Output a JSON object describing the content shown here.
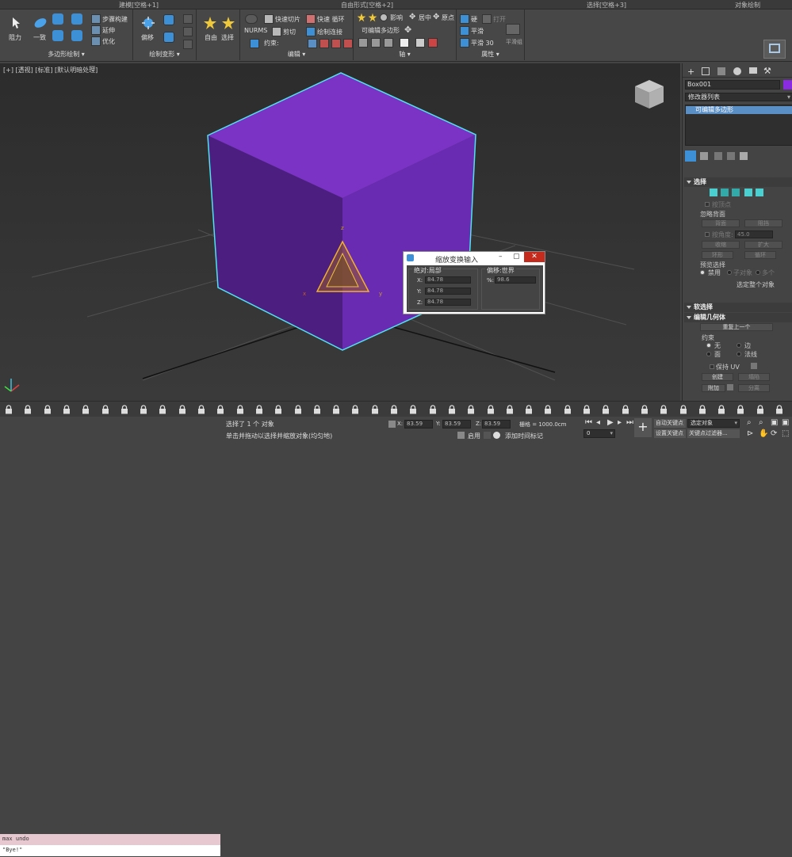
{
  "ribbon": {
    "tabs": [
      "建模[空格+1]",
      "自由形式[空格+2]",
      "选择[空格+3]",
      "对象绘制"
    ],
    "groups": {
      "poly": {
        "label": "多边形绘制",
        "items": [
          "阻力",
          "一致",
          "步骤构建",
          "延伸",
          "优化"
        ]
      },
      "deform": {
        "label": "绘制变形",
        "items": [
          "偏移"
        ]
      },
      "freeform": {
        "items": [
          "自由",
          "选择"
        ]
      },
      "edit": {
        "label": "编辑",
        "items": [
          "NURMS",
          "快速切片",
          "剪切",
          "快速 循环",
          "绘制连接",
          "约束:",
          "可编辑多边形"
        ]
      },
      "axis": {
        "label": "轴",
        "items": [
          "影响",
          "居中",
          "原点"
        ]
      },
      "props": {
        "label": "属性",
        "items": [
          "硬",
          "平滑",
          "平滑 30",
          "打开",
          "平滑组"
        ]
      }
    }
  },
  "viewport": {
    "label": "[+] [透视] [标准] [默认明暗处理]",
    "gizmo_labels": {
      "x": "x",
      "y": "y",
      "z": "z"
    },
    "cube_color": "#6a2bb3",
    "wire_color": "#4fe3f0"
  },
  "command_panel": {
    "object_name": "Box001",
    "object_color": "#8a2be2",
    "modifier_list": "修改器列表",
    "stack_item": "可编辑多边形",
    "selection": {
      "title": "选择",
      "by_vertex": "按顶点",
      "ignore_back": "忽略背面",
      "by_angle": "按角度:",
      "angle_value": "45.0",
      "shrink": "收缩",
      "grow": "扩大",
      "ring": "环形",
      "loop": "循环",
      "preview_title": "预览选择",
      "preview_opts": [
        "禁用",
        "子对象",
        "多个"
      ],
      "status": "选定整个对象",
      "front": "背面",
      "occluded": "阻挡"
    },
    "soft_selection": "软选择",
    "edit_geometry": {
      "title": "编辑几何体",
      "repeat_last": "重复上一个",
      "constraints": "约束",
      "constraint_opts": [
        "无",
        "边",
        "面",
        "法线"
      ],
      "preserve_uvs": "保持 UV",
      "create": "创建",
      "collapse": "塌陷",
      "attach": "附加",
      "detach": "分离"
    }
  },
  "dialog": {
    "title": "缩放变换输入",
    "absolute_label": "绝对:局部",
    "offset_label": "偏移:世界",
    "x_label": "X:",
    "y_label": "Y:",
    "z_label": "Z:",
    "x_value": "84.78",
    "y_value": "84.78",
    "z_value": "84.78",
    "pct_label": "%:",
    "pct_value": "98.6"
  },
  "status": {
    "maxscript_line1": "max undo",
    "maxscript_line2": "\"Bye!\"",
    "selected": "选择了 1 个 对象",
    "prompt": "单击并拖动以选择并缩放对象(均匀地)",
    "x_label": "X:",
    "x_value": "83.59",
    "y_label": "Y:",
    "y_value": "83.59",
    "z_label": "Z:",
    "z_value": "83.59",
    "grid": "栅格 = 1000.0cm",
    "enable": "启用",
    "add_time_tag": "添加时间标记",
    "auto_key": "自动关键点",
    "set_key": "设置关键点",
    "selection_set": "选定对象",
    "key_filters": "关键点过滤器...",
    "frame": "0"
  }
}
